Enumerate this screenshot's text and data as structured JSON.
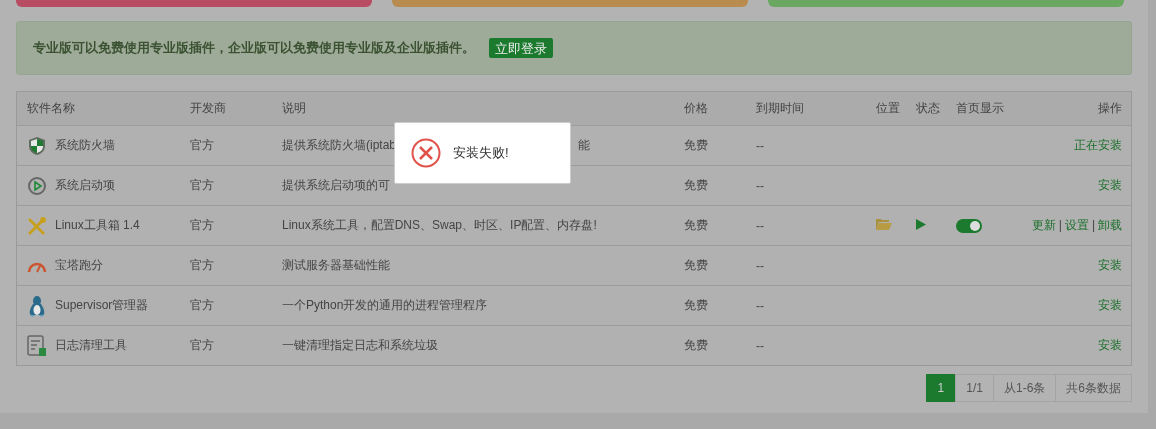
{
  "top_cards": [
    {
      "color": "#b84c62"
    },
    {
      "color": "#b88c4e"
    },
    {
      "color": "#6aa862"
    }
  ],
  "notice": {
    "text": "专业版可以免费使用专业版插件，企业版可以免费使用专业版及企业版插件。",
    "button": "立即登录"
  },
  "table": {
    "columns": [
      "软件名称",
      "开发商",
      "说明",
      "价格",
      "到期时间",
      "位置",
      "状态",
      "首页显示",
      "操作"
    ],
    "separator": "|",
    "rows": [
      {
        "kind": "shield",
        "name": "系统防火墙",
        "developer": "官方",
        "description": "提供系统防火墙(iptab",
        "description_tail": "能",
        "price": "免费",
        "expiry": "--",
        "actions": [
          "正在安装"
        ]
      },
      {
        "kind": "play",
        "name": "系统启动项",
        "developer": "官方",
        "description": "提供系统启动项的可",
        "price": "免费",
        "expiry": "--",
        "actions": [
          "安装"
        ]
      },
      {
        "kind": "tools",
        "name": "Linux工具箱 1.4",
        "developer": "官方",
        "description": "Linux系统工具，配置DNS、Swap、时区、IP配置、内存盘!",
        "price": "免费",
        "expiry": "--",
        "location": true,
        "running": true,
        "home_display": true,
        "actions": [
          "更新",
          "设置",
          "卸载"
        ]
      },
      {
        "kind": "gauge",
        "name": "宝塔跑分",
        "developer": "官方",
        "description": "测试服务器基础性能",
        "price": "免费",
        "expiry": "--",
        "actions": [
          "安装"
        ]
      },
      {
        "kind": "penguin",
        "name": "Supervisor管理器",
        "developer": "官方",
        "description": "一个Python开发的通用的进程管理程序",
        "price": "免费",
        "expiry": "--",
        "actions": [
          "安装"
        ]
      },
      {
        "kind": "log",
        "name": "日志清理工具",
        "developer": "官方",
        "description": "一键清理指定日志和系统垃圾",
        "price": "免费",
        "expiry": "--",
        "actions": [
          "安装"
        ]
      }
    ]
  },
  "pager": {
    "pages": [
      {
        "label": "1",
        "selected": true
      }
    ],
    "info": [
      "1/1",
      "从1-6条",
      "共6条数据"
    ]
  },
  "toast": {
    "kind": "error",
    "text": "安装失败!"
  }
}
